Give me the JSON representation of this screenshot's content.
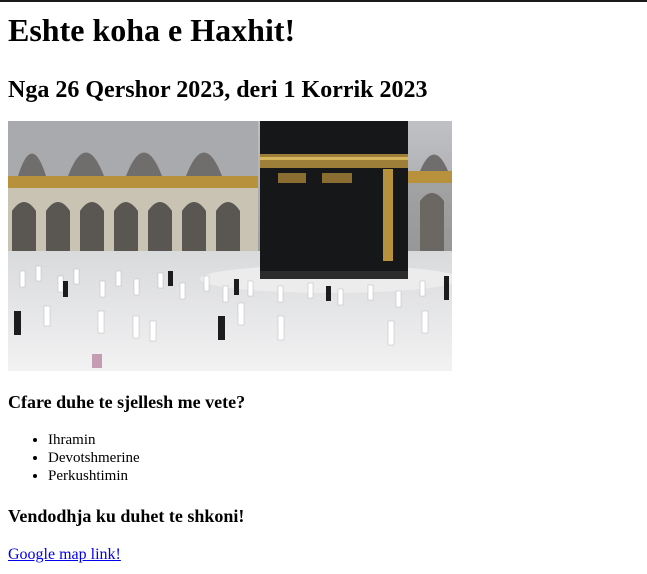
{
  "page": {
    "title": "Eshte koha e Haxhit!",
    "subtitle": "Nga 26 Qershor 2023, deri 1 Korrik 2023",
    "image": {
      "subject": "kaaba-mataf-photo"
    },
    "question": "Cfare duhe te sjellesh me vete?",
    "items": [
      "Ihramin",
      "Devotshmerine",
      "Perkushtimin"
    ],
    "location_heading": "Vendodhja ku duhet te shkoni!",
    "map_link": "Google map link!",
    "colors": {
      "link": "#0000ee",
      "text": "#000000",
      "background": "#ffffff"
    }
  }
}
